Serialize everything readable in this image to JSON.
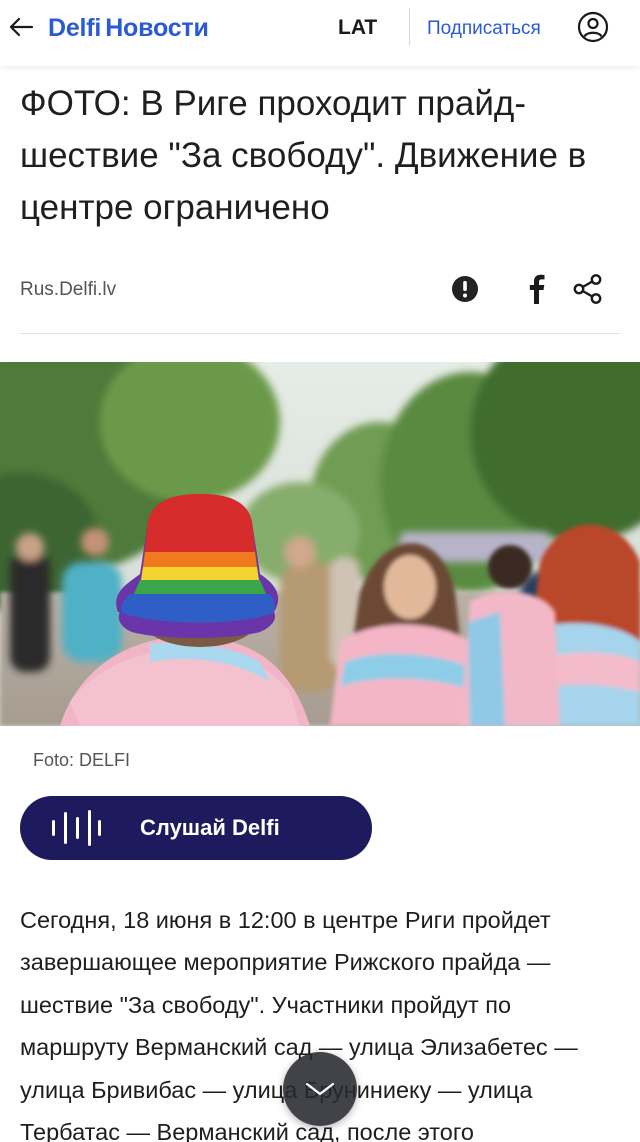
{
  "header": {
    "logo_brand": "Delfi",
    "logo_section": "Новости",
    "lang": "LAT",
    "subscribe": "Подписаться"
  },
  "article": {
    "title": "ФОТО: В Риге проходит прайд-шествие \"За свободу\". Движение в центре ограничено",
    "source": "Rus.Delfi.lv",
    "photo_caption": "Foto: DELFI",
    "listen_label": "Слушай Delfi",
    "body": "Сегодня, 18 июня в 12:00 в центре Риги пройдет завершающее мероприятие Рижского прайда — шествие \"За свободу\". Участники пройдут по маршруту Верманский сад — улица Элизабетес — улица Бривибас — улица Бруниниеку — улица Тербатас — Верманский сад, после этого"
  },
  "icons": {
    "back": "arrow-left-icon",
    "profile": "user-circle-icon",
    "report": "exclamation-circle-icon",
    "facebook": "facebook-icon",
    "share": "share-icon",
    "listen": "sound-wave-icon",
    "scroll": "chevron-down-icon"
  },
  "colors": {
    "brand_blue": "#2b5ad6",
    "listen_bg": "#1d1a5e",
    "fab_bg": "#28282f"
  }
}
